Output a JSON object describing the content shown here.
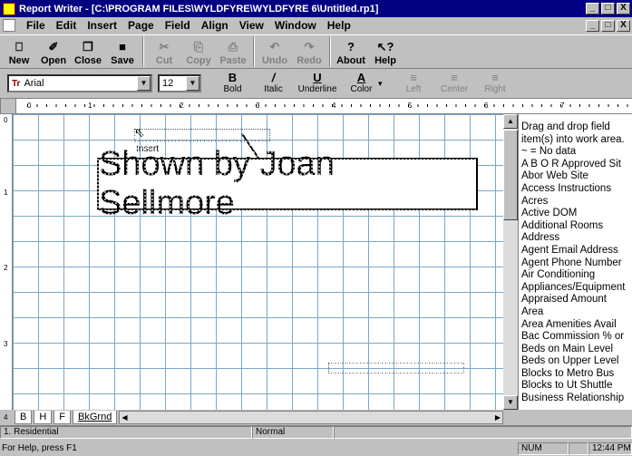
{
  "window": {
    "title": "Report Writer - [C:\\PROGRAM FILES\\WYLDFYRE\\WYLDFYRE 6\\Untitled.rp1]",
    "controls": [
      "_",
      "□",
      "X"
    ]
  },
  "menu": {
    "items": [
      "File",
      "Edit",
      "Insert",
      "Page",
      "Field",
      "Align",
      "View",
      "Window",
      "Help"
    ],
    "doc_controls": [
      "_",
      "□",
      "X"
    ]
  },
  "toolbar": {
    "buttons": [
      {
        "label": "New",
        "icon": "⎕",
        "enabled": true
      },
      {
        "label": "Open",
        "icon": "✐",
        "enabled": true
      },
      {
        "label": "Close",
        "icon": "❐",
        "enabled": true
      },
      {
        "label": "Save",
        "icon": "■",
        "enabled": true
      },
      {
        "label": "Cut",
        "icon": "✂",
        "enabled": false
      },
      {
        "label": "Copy",
        "icon": "⎘",
        "enabled": false
      },
      {
        "label": "Paste",
        "icon": "⎙",
        "enabled": false
      },
      {
        "label": "Undo",
        "icon": "↶",
        "enabled": false
      },
      {
        "label": "Redo",
        "icon": "↷",
        "enabled": false
      },
      {
        "label": "About",
        "icon": "?",
        "enabled": true
      },
      {
        "label": "Help",
        "icon": "↖?",
        "enabled": true
      }
    ]
  },
  "format_bar": {
    "font": "Arial",
    "font_icon": "Tr",
    "size": "12",
    "bold": "Bold",
    "italic": "Italic",
    "underline": "Underline",
    "color": "Color",
    "left": "Left",
    "center": "Center",
    "right": "Right"
  },
  "ruler": {
    "marks": [
      "0",
      "1",
      "2",
      "3",
      "4",
      "5",
      "6",
      "7"
    ],
    "vmarks": [
      "0",
      "1",
      "2",
      "3",
      "4"
    ]
  },
  "canvas": {
    "banner_text": "Shown by Joan Sellmore",
    "insert_label": "Insert"
  },
  "field_panel": {
    "intro": [
      "Drag and drop field",
      "item(s) into work area.",
      "~ = No data"
    ],
    "items": [
      "A B O R  Approved Sit",
      "Abor Web Site",
      "Access Instructions",
      "Acres",
      "Active DOM",
      "Additional Rooms",
      "Address",
      "Agent Email Address",
      "Agent Phone Number",
      "Air Conditioning",
      "Appliances/Equipment",
      "Appraised Amount",
      "Area",
      "Area Amenities Avail",
      "Bac Commission % or",
      "Beds on Main Level",
      "Beds on Upper Level",
      "Blocks to Metro Bus",
      "Blocks to Ut Shuttle",
      "Business Relationship"
    ]
  },
  "tabs": [
    "B",
    "H",
    "F",
    "BkGrnd"
  ],
  "status": {
    "section": "1. Residential",
    "mode": "Normal",
    "help": "For Help, press F1",
    "num": "NUM",
    "time": "12:44 PM"
  },
  "colors": {
    "title_bg": "#000080",
    "chrome": "#c0c0c0",
    "grid": "#7aa7c7"
  }
}
